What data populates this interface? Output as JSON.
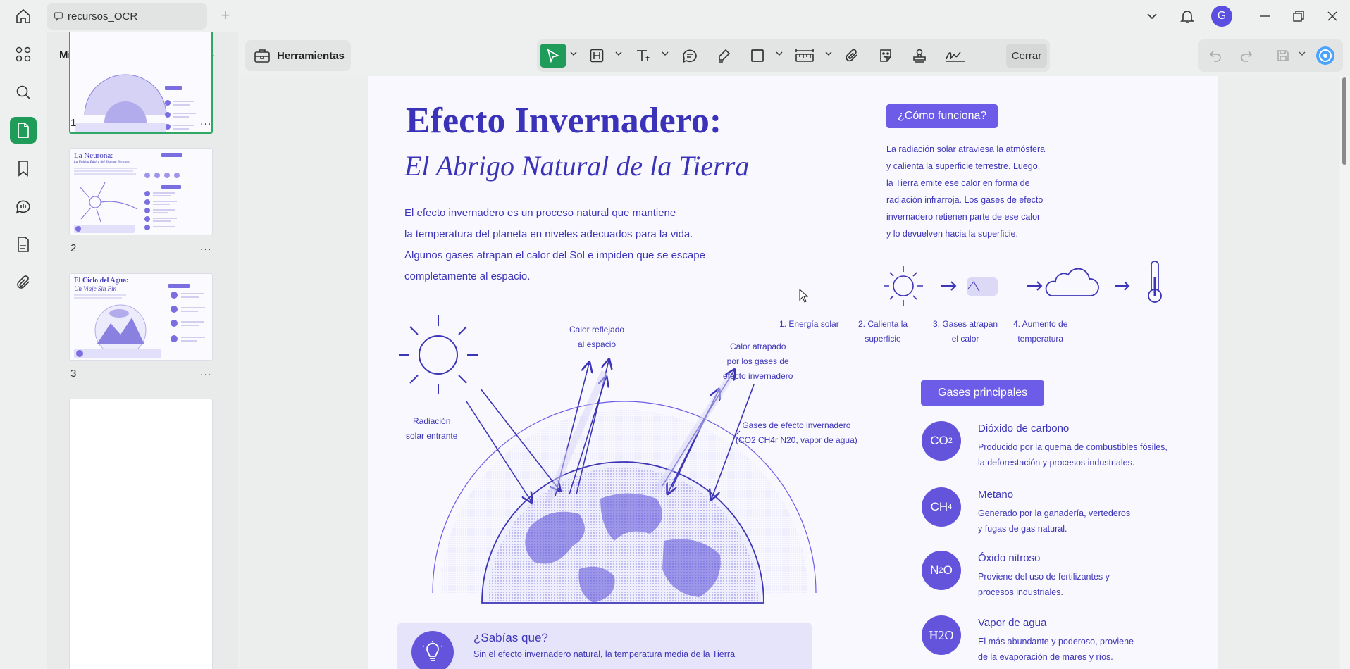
{
  "app": {
    "tab_title": "recursos_OCR",
    "avatar_letter": "G",
    "accent": "#1f9c5a"
  },
  "thumbnails": {
    "title": "Miniaturas",
    "pages": [
      {
        "number": "1",
        "more": "..."
      },
      {
        "number": "2",
        "more": "...",
        "title": "La Neurona:",
        "subtitle": "La Unidad Básica del Sistema Nervioso"
      },
      {
        "number": "3",
        "more": "...",
        "title": "El Ciclo del Agua:",
        "subtitle": "Un Viaje Sin Fin"
      },
      {
        "number": "",
        "more": ""
      }
    ]
  },
  "toolbar": {
    "tools_label": "Herramientas",
    "close_label": "Cerrar"
  },
  "document": {
    "title": "Efecto Invernadero:",
    "subtitle": "El Abrigo Natural de la Tierra",
    "intro": [
      "El efecto invernadero es un proceso natural que mantiene",
      "la temperatura del planeta en niveles adecuados para la vida.",
      "Algunos gases atrapan el calor del Sol e impiden que se escape",
      "completamente al espacio."
    ],
    "diagram": {
      "incoming": [
        "Radiación",
        "solar entrante"
      ],
      "reflected": [
        "Calor reflejado",
        "al espacio"
      ],
      "trapped": [
        "Calor atrapado",
        "por los gases de",
        "efecto invernadero"
      ],
      "gases": [
        "Gases de efecto invernadero",
        "(CO2 CH4r N20, vapor de agua)"
      ]
    },
    "how": {
      "badge": "¿Cómo funciona?",
      "text": [
        "La radiación solar atraviesa la atmósfera",
        "y calienta la superficie terrestre. Luego,",
        "la Tierra emite ese calor en forma de",
        "radiación infrarroja. Los gases de efecto",
        "invernadero retienen parte de ese calor",
        "y lo devuelven hacia la superficie."
      ],
      "steps": [
        [
          "1. Energía solar"
        ],
        [
          "2. Calienta la",
          "superficie"
        ],
        [
          "3. Gases atrapan",
          "el calor"
        ],
        [
          "4. Aumento de",
          "temperatura"
        ]
      ]
    },
    "gases": {
      "badge": "Gases principales",
      "items": [
        {
          "symbol": "CO",
          "sub": "2",
          "name": "Dióxido de carbono",
          "desc": [
            "Producido por la quema de combustibles fósiles,",
            "la deforestación y procesos industriales."
          ]
        },
        {
          "symbol": "CH",
          "sub": "4",
          "name": "Metano",
          "desc": [
            "Generado por la ganadería, vertederos",
            "y fugas de gas natural."
          ]
        },
        {
          "symbol": "N",
          "sub": "2",
          "symbol_after": "O",
          "name": "Óxido nitroso",
          "desc": [
            "Proviene del uso de fertilizantes y",
            "procesos industriales."
          ]
        },
        {
          "symbol": "H2O",
          "sub": "",
          "name": "Vapor de agua",
          "desc": [
            "El más abundante y poderoso, proviene",
            "de la evaporación de mares y ríos."
          ]
        }
      ]
    },
    "didyou": {
      "title": "¿Sabías que?",
      "text": "Sin el efecto invernadero natural, la temperatura media de la Tierra"
    }
  }
}
